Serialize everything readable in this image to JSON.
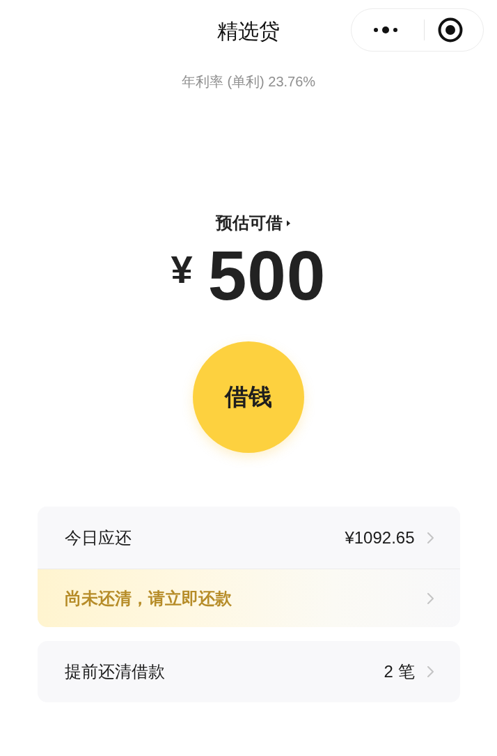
{
  "nav": {
    "title": "精选贷"
  },
  "rate": "年利率 (单利) 23.76%",
  "quota": {
    "label": "预估可借",
    "currency": "¥",
    "amount": "500"
  },
  "borrow_button": "借钱",
  "cards": [
    {
      "rows": [
        {
          "kind": "amount",
          "label": "今日应还",
          "value": "¥1092.65"
        },
        {
          "kind": "alert",
          "label": "尚未还清，请立即还款"
        }
      ]
    },
    {
      "rows": [
        {
          "kind": "amount",
          "label": "提前还清借款",
          "value": "2 笔"
        }
      ]
    }
  ]
}
